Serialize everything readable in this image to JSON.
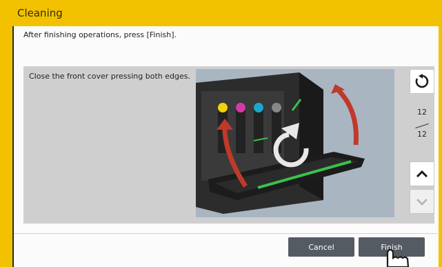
{
  "header": {
    "title": "Cleaning"
  },
  "instruction": "After finishing operations, press [Finish].",
  "step": {
    "text": "Close the front cover pressing both edges."
  },
  "pager": {
    "current": "12",
    "total": "12"
  },
  "buttons": {
    "cancel": "Cancel",
    "finish": "Finish"
  },
  "icons": {
    "replay": "replay-icon",
    "up": "chevron-up-icon",
    "down": "chevron-down-icon",
    "pointer": "hand-pointer-icon",
    "close_rotation": "rotate-ccw-icon"
  },
  "colors": {
    "title_bar": "#f2c200",
    "button": "#555b63",
    "toner_yellow": "#f2d20c",
    "toner_magenta": "#d23aa8",
    "toner_cyan": "#18a8d0",
    "toner_black": "#888888",
    "arrow_red": "#c0392b",
    "highlight_green": "#39c24a"
  }
}
